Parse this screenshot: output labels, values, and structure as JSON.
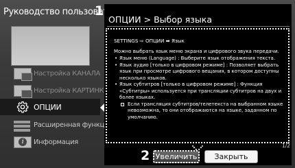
{
  "sidebar": {
    "title": "Руководство пользователя",
    "callout": "1",
    "items": [
      {
        "label": "Настройка КАНАЛА",
        "icon": "tv-channel-icon"
      },
      {
        "label": "Настройка КАРТИНКИ, ЗВУКА",
        "icon": "tv-picture-icon"
      },
      {
        "label": "ОПЦИИ",
        "icon": "gear-icon"
      },
      {
        "label": "Расширенная функция",
        "icon": "extended-function-icon"
      },
      {
        "label": "Информация",
        "icon": "info-icon"
      }
    ]
  },
  "panel": {
    "title": "ОПЦИИ > Выбор языка",
    "breadcrumb": "SETTINGS ⇨ ОПЦИИ ➡ Язык",
    "intro": "Можно выбрать язык меню экрана и цифрового звука передачи.",
    "bullets": [
      "Язык меню (Language) : Выберите язык отображения текста.",
      "Язык аудио [только в цифровом режиме] : Позволяет выбрать язык при просмотре цифрового вещания, в котором доступны несколько языков.",
      "Язык субтитров [только в цифровом режиме] : Функция «Субтитры» используется при трансляции субтитров на двух и более языках."
    ],
    "note": "Если трансляция субтитров/телетекста на выбранном языке невозможна, то они отображаются на языке, заданном по умолчанию.",
    "page_indicator": "1/2"
  },
  "buttons": {
    "callout": "2",
    "zoom": "Увеличить",
    "close": "Закрыть"
  }
}
